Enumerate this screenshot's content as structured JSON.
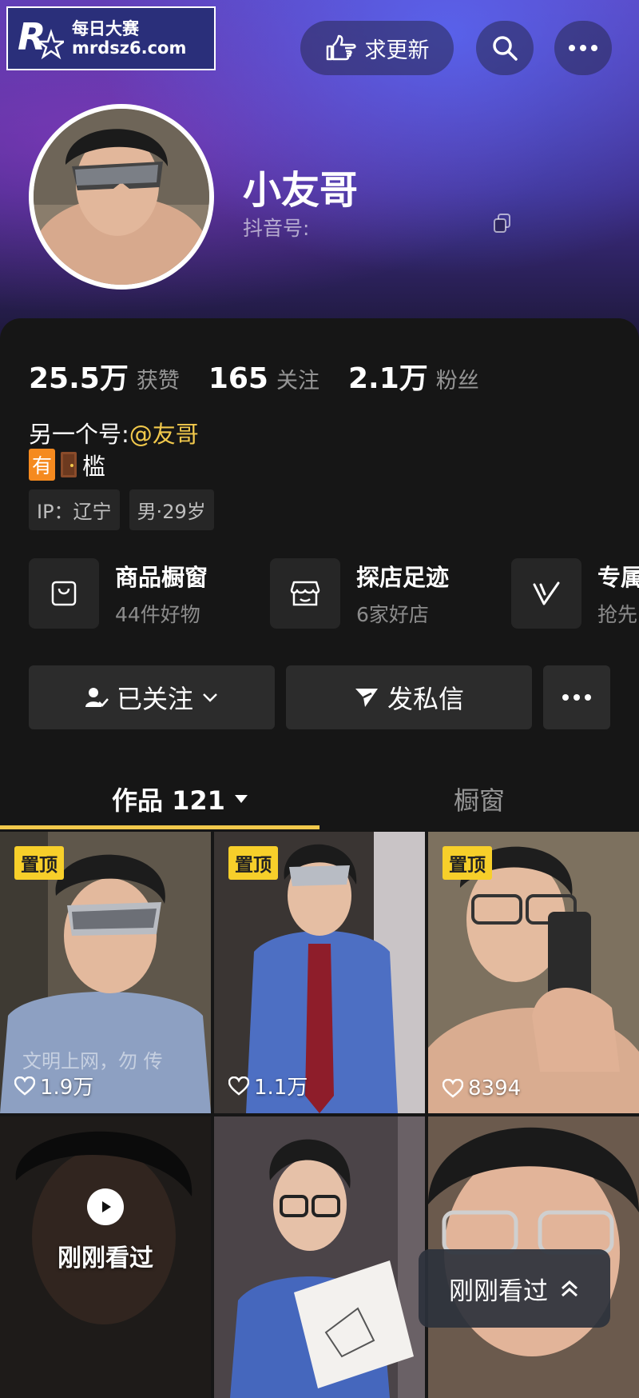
{
  "watermark": {
    "line1": "每日大赛",
    "line2": "mrdsz6.com",
    "logo_letter": "R",
    "logo_sub": "每日大赛"
  },
  "top_bar": {
    "update_label": "求更新"
  },
  "profile": {
    "nickname": "小友哥",
    "douyin_id_label": "抖音号:"
  },
  "stats": [
    {
      "value": "25.5万",
      "label": "获赞"
    },
    {
      "value": "165",
      "label": "关注"
    },
    {
      "value": "2.1万",
      "label": "粉丝"
    }
  ],
  "bio": {
    "prefix": "另一个号:",
    "mention": "@友哥",
    "badge": "有",
    "line2_text": "槛"
  },
  "tags": [
    "IP：辽宁",
    "男·29岁"
  ],
  "services": [
    {
      "title": "商品橱窗",
      "sub": "44件好物"
    },
    {
      "title": "探店足迹",
      "sub": "6家好店"
    },
    {
      "title": "专属",
      "sub": "抢先"
    }
  ],
  "actions": {
    "follow_label": "已关注",
    "message_label": "发私信"
  },
  "tabs": {
    "works_label": "作品 121",
    "window_label": "橱窗"
  },
  "videos": [
    {
      "pinned_label": "置顶",
      "likes": "1.9万",
      "caption": "文明上网，勿 传"
    },
    {
      "pinned_label": "置顶",
      "likes": "1.1万"
    },
    {
      "pinned_label": "置顶",
      "likes": "8394"
    }
  ],
  "recently_watched": {
    "label": "刚刚看过"
  },
  "float_button": {
    "label": "刚刚看过"
  },
  "colors": {
    "accent": "#f2c94c",
    "pin": "#f7cf2a",
    "badge": "#f58a1f",
    "panel": "#161616",
    "button": "#2c2c2c"
  }
}
